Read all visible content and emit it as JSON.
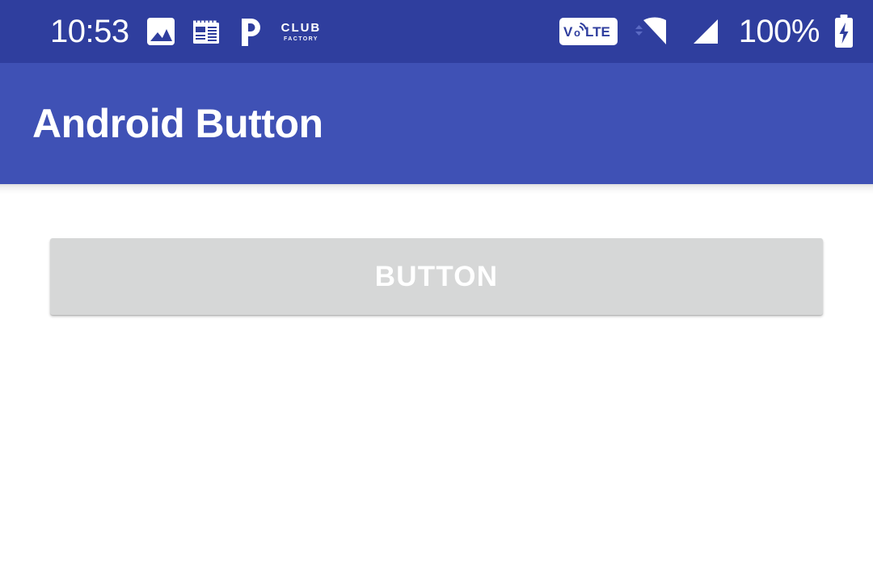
{
  "status_bar": {
    "time": "10:53",
    "battery_percent": "100%",
    "volte_label": "VoLTE",
    "club_factory": {
      "line1": "CLUB",
      "line2": "FACTORY"
    },
    "notification_icons": [
      "photo-icon",
      "news-icon",
      "phonepe-icon",
      "club-factory-icon"
    ],
    "system_icons": [
      "volte-badge",
      "wifi-icon",
      "cellular-signal-icon",
      "battery-charging-icon"
    ],
    "colors": {
      "background": "#2f3e9e",
      "foreground": "#ffffff"
    }
  },
  "app_bar": {
    "title": "Android Button",
    "colors": {
      "background": "#3f51b5",
      "title": "#ffffff"
    }
  },
  "content": {
    "background": "#ffffff",
    "button": {
      "label": "BUTTON",
      "background": "#d6d7d7",
      "text_color": "#ffffff"
    }
  }
}
